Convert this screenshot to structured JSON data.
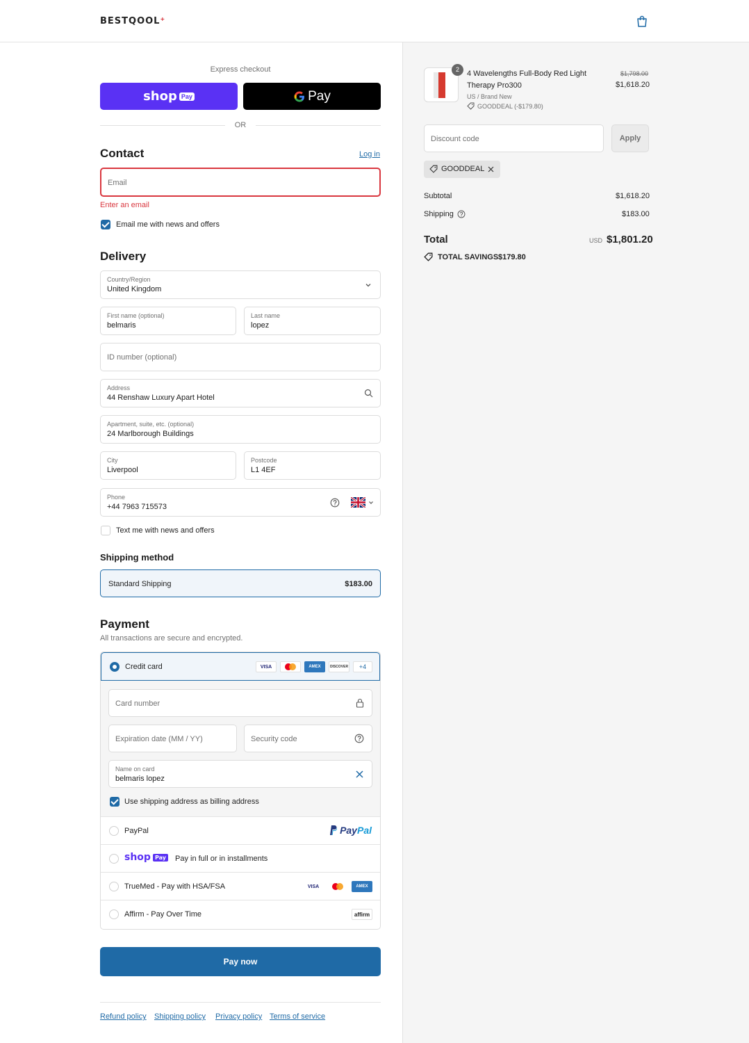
{
  "header": {
    "logo": "BESTQOOL",
    "logo_mark": "+"
  },
  "express": {
    "label": "Express checkout",
    "shoppay_word": "shop",
    "shoppay_badge": "Pay",
    "gpay_label": "Pay",
    "or": "OR"
  },
  "contact": {
    "title": "Contact",
    "login": "Log in",
    "email_placeholder": "Email",
    "email_error": "Enter an email",
    "newsletter": "Email me with news and offers"
  },
  "delivery": {
    "title": "Delivery",
    "country_label": "Country/Region",
    "country_value": "United Kingdom",
    "first_label": "First name (optional)",
    "first_value": "belmaris",
    "last_label": "Last name",
    "last_value": "lopez",
    "id_placeholder": "ID number (optional)",
    "address_label": "Address",
    "address_value": "44 Renshaw Luxury Apart Hotel",
    "apt_label": "Apartment, suite, etc. (optional)",
    "apt_value": "24 Marlborough Buildings",
    "city_label": "City",
    "city_value": "Liverpool",
    "postcode_label": "Postcode",
    "postcode_value": "L1 4EF",
    "phone_label": "Phone",
    "phone_value": "+44 7963 715573",
    "sms": "Text me with news and offers"
  },
  "shipping": {
    "title": "Shipping method",
    "option": "Standard Shipping",
    "price": "$183.00"
  },
  "payment": {
    "title": "Payment",
    "subtitle": "All transactions are secure and encrypted.",
    "credit_card": "Credit card",
    "card_more": "+4",
    "logos": {
      "visa": "VISA",
      "amex": "AMEX",
      "discover": "DISCOVER"
    },
    "card_number": "Card number",
    "expiry": "Expiration date (MM / YY)",
    "security": "Security code",
    "name_label": "Name on card",
    "name_value": "belmaris lopez",
    "billing": "Use shipping address as billing address",
    "paypal": "PayPal",
    "paypal_logo_a": "Pay",
    "paypal_logo_b": "Pal",
    "shoppay_text": "Pay in full or in installments",
    "shoppay_word": "shop",
    "shoppay_badge": "Pay",
    "truemed": "TrueMed - Pay with HSA/FSA",
    "affirm": "Affirm - Pay Over Time",
    "affirm_logo": "affirm",
    "pay_now": "Pay now"
  },
  "footer": {
    "links": [
      "Refund policy",
      "Shipping policy",
      "Privacy policy",
      "Terms of service"
    ]
  },
  "summary": {
    "qty": "2",
    "product_line1": "4 Wavelengths Full-Body Red Light",
    "product_line2": "Therapy Pro300",
    "variant": "US / Brand New",
    "discount_tag": "GOODDEAL (-$179.80)",
    "original_price": "$1,798.00",
    "price": "$1,618.20",
    "discount_placeholder": "Discount code",
    "apply": "Apply",
    "chip": "GOODDEAL",
    "subtotal_label": "Subtotal",
    "subtotal": "$1,618.20",
    "shipping_label": "Shipping",
    "shipping": "$183.00",
    "total_label": "Total",
    "currency": "USD",
    "total": "$1,801.20",
    "savings_label": "TOTAL SAVINGS",
    "savings": "$179.80"
  },
  "colors": {
    "accent": "#1f6aa6",
    "shoppay": "#5a31f4",
    "error": "#d9363e"
  }
}
